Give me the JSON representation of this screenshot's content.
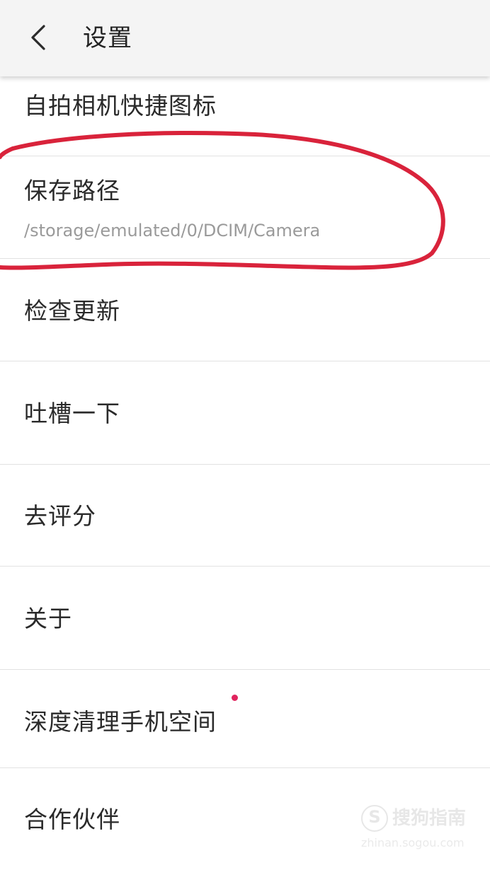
{
  "header": {
    "title": "设置",
    "back_icon": "chevron-left-icon"
  },
  "settings": {
    "items": [
      {
        "label": "自拍相机快捷图标"
      },
      {
        "label": "保存路径",
        "sub": "/storage/emulated/0/DCIM/Camera"
      },
      {
        "label": "检查更新"
      },
      {
        "label": "吐槽一下"
      },
      {
        "label": "去评分"
      },
      {
        "label": "关于"
      },
      {
        "label": "深度清理手机空间"
      },
      {
        "label": "合作伙伴"
      }
    ]
  },
  "annotation": {
    "color": "#d9233b",
    "shape": "hand-drawn-ellipse"
  },
  "notification_dot_color": "#e0245e",
  "watermark": {
    "brand": "搜狗指南",
    "url": "zhinan.sogou.com",
    "icon": "sogou-s-logo"
  }
}
